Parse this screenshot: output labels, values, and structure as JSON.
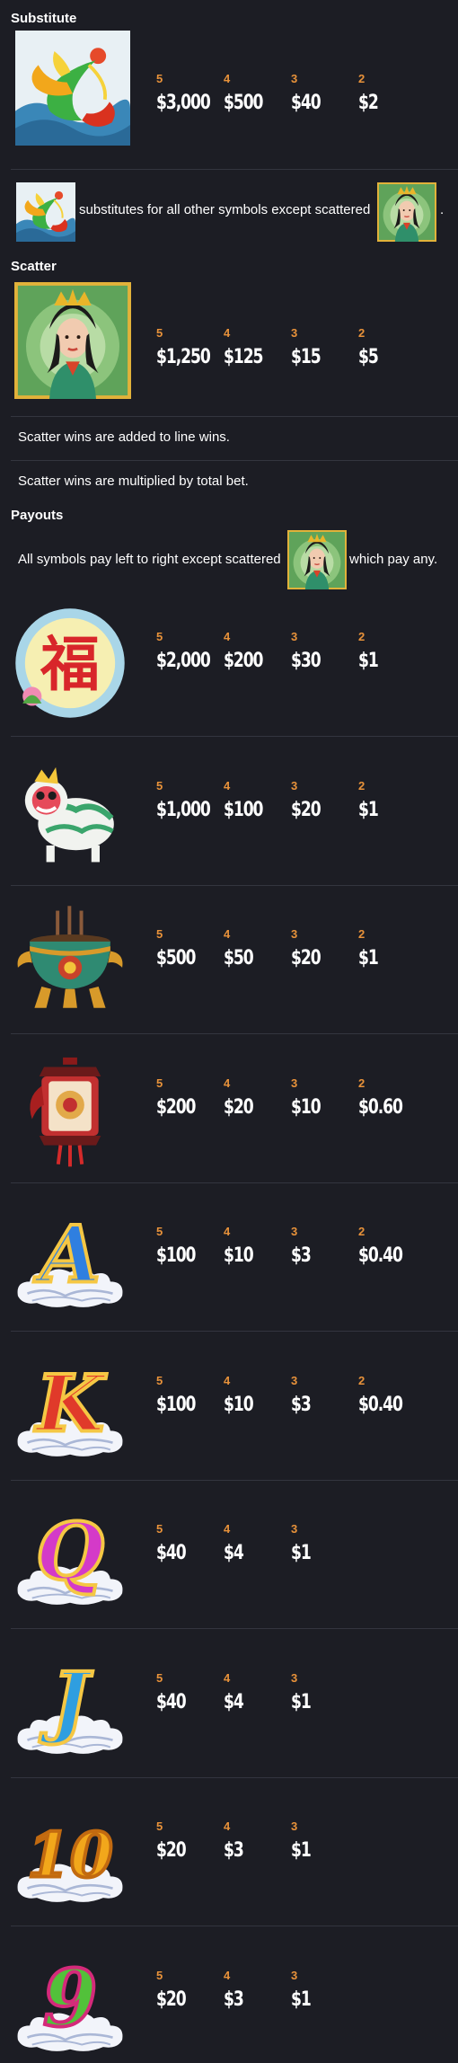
{
  "sections": {
    "substitute": "Substitute",
    "scatter": "Scatter",
    "payouts": "Payouts"
  },
  "substitute": {
    "symbol": "phoenix-icon",
    "pays": [
      {
        "count": "5",
        "amount": "$3,000"
      },
      {
        "count": "4",
        "amount": "$500"
      },
      {
        "count": "3",
        "amount": "$40"
      },
      {
        "count": "2",
        "amount": "$2"
      }
    ],
    "note": "substitutes for all other symbols except scattered",
    "note_end": "."
  },
  "scatter": {
    "symbol": "empress-icon",
    "pays": [
      {
        "count": "5",
        "amount": "$1,250"
      },
      {
        "count": "4",
        "amount": "$125"
      },
      {
        "count": "3",
        "amount": "$15"
      },
      {
        "count": "2",
        "amount": "$5"
      }
    ],
    "notes": [
      "Scatter wins are added to line wins.",
      "Scatter wins are multiplied by total bet."
    ]
  },
  "payouts": {
    "intro_before": "All symbols pay left to right except scattered",
    "intro_after": "which pay any.",
    "rows": [
      {
        "symbol": "fortune-coin-icon",
        "pays": [
          {
            "count": "5",
            "amount": "$2,000"
          },
          {
            "count": "4",
            "amount": "$200"
          },
          {
            "count": "3",
            "amount": "$30"
          },
          {
            "count": "2",
            "amount": "$1"
          }
        ]
      },
      {
        "symbol": "lion-dancer-icon",
        "pays": [
          {
            "count": "5",
            "amount": "$1,000"
          },
          {
            "count": "4",
            "amount": "$100"
          },
          {
            "count": "3",
            "amount": "$20"
          },
          {
            "count": "2",
            "amount": "$1"
          }
        ]
      },
      {
        "symbol": "incense-burner-icon",
        "pays": [
          {
            "count": "5",
            "amount": "$500"
          },
          {
            "count": "4",
            "amount": "$50"
          },
          {
            "count": "3",
            "amount": "$20"
          },
          {
            "count": "2",
            "amount": "$1"
          }
        ]
      },
      {
        "symbol": "lantern-icon",
        "pays": [
          {
            "count": "5",
            "amount": "$200"
          },
          {
            "count": "4",
            "amount": "$20"
          },
          {
            "count": "3",
            "amount": "$10"
          },
          {
            "count": "2",
            "amount": "$0.60"
          }
        ]
      },
      {
        "symbol": "letter-a-icon",
        "letter": "A",
        "pays": [
          {
            "count": "5",
            "amount": "$100"
          },
          {
            "count": "4",
            "amount": "$10"
          },
          {
            "count": "3",
            "amount": "$3"
          },
          {
            "count": "2",
            "amount": "$0.40"
          }
        ]
      },
      {
        "symbol": "letter-k-icon",
        "letter": "K",
        "pays": [
          {
            "count": "5",
            "amount": "$100"
          },
          {
            "count": "4",
            "amount": "$10"
          },
          {
            "count": "3",
            "amount": "$3"
          },
          {
            "count": "2",
            "amount": "$0.40"
          }
        ]
      },
      {
        "symbol": "letter-q-icon",
        "letter": "Q",
        "pays": [
          {
            "count": "5",
            "amount": "$40"
          },
          {
            "count": "4",
            "amount": "$4"
          },
          {
            "count": "3",
            "amount": "$1"
          }
        ]
      },
      {
        "symbol": "letter-j-icon",
        "letter": "J",
        "pays": [
          {
            "count": "5",
            "amount": "$40"
          },
          {
            "count": "4",
            "amount": "$4"
          },
          {
            "count": "3",
            "amount": "$1"
          }
        ]
      },
      {
        "symbol": "number-10-icon",
        "letter": "10",
        "pays": [
          {
            "count": "5",
            "amount": "$20"
          },
          {
            "count": "4",
            "amount": "$3"
          },
          {
            "count": "3",
            "amount": "$1"
          }
        ]
      },
      {
        "symbol": "number-9-icon",
        "letter": "9",
        "pays": [
          {
            "count": "5",
            "amount": "$20"
          },
          {
            "count": "4",
            "amount": "$3"
          },
          {
            "count": "3",
            "amount": "$1"
          }
        ]
      }
    ]
  },
  "colors": {
    "background": "#1c1d24",
    "count": "#e8923a",
    "amount": "#ffffff",
    "divider": "#33353f"
  }
}
